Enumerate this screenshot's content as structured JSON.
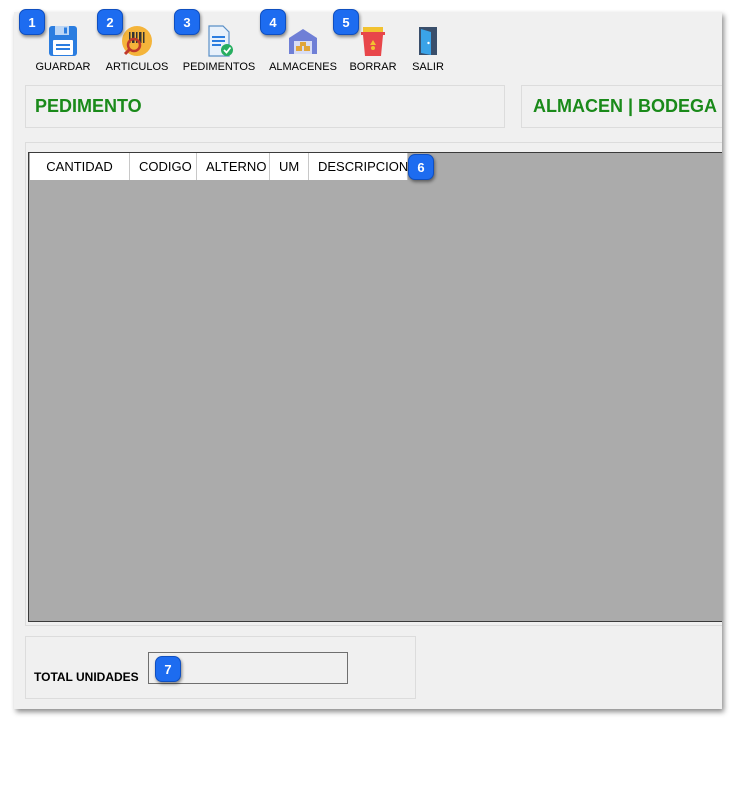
{
  "toolbar": {
    "guardar": {
      "label": "GUARDAR",
      "icon": "floppy-disk-icon"
    },
    "articulos": {
      "label": "ARTICULOS",
      "icon": "barcode-search-icon"
    },
    "pedimentos": {
      "label": "PEDIMENTOS",
      "icon": "document-check-icon"
    },
    "almacenes": {
      "label": "ALMACENES",
      "icon": "warehouse-icon"
    },
    "borrar": {
      "label": "BORRAR",
      "icon": "trash-bin-icon"
    },
    "salir": {
      "label": "SALIR",
      "icon": "exit-door-icon"
    }
  },
  "groups": {
    "pedimento_title": "PEDIMENTO",
    "almacen_title": "ALMACEN | BODEGA"
  },
  "grid": {
    "columns": [
      "CANTIDAD",
      "CODIGO",
      "ALTERNO",
      "UM",
      "DESCRIPCION"
    ],
    "rows": []
  },
  "totals": {
    "label": "TOTAL UNIDADES",
    "value": ""
  },
  "callouts": [
    "1",
    "2",
    "3",
    "4",
    "5",
    "6",
    "7"
  ],
  "colors": {
    "accent_title": "#1a8a1a",
    "callout_blue": "#1d6cf0",
    "grid_background": "#ababab"
  }
}
